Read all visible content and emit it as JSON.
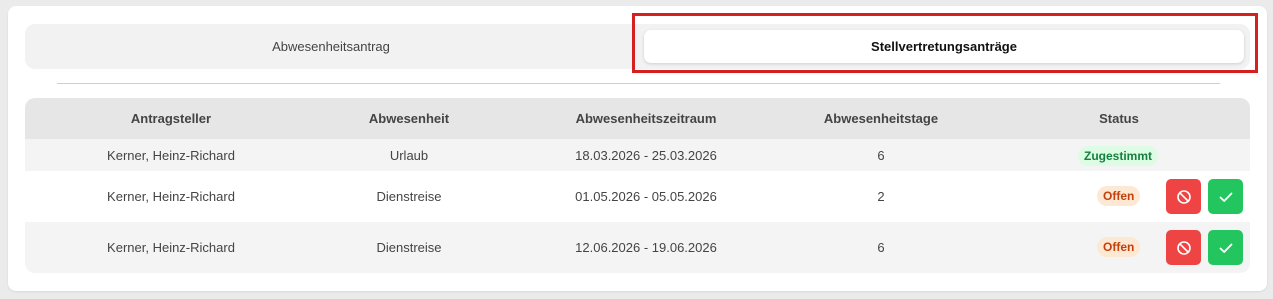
{
  "tabs": [
    {
      "label": "Abwesenheitsantrag",
      "active": false
    },
    {
      "label": "Stellvertretungsanträge",
      "active": true
    }
  ],
  "table": {
    "headers": [
      "Antragsteller",
      "Abwesenheit",
      "Abwesenheitszeitraum",
      "Abwesenheitstage",
      "Status"
    ],
    "rows": [
      {
        "applicant": "Kerner, Heinz-Richard",
        "absence": "Urlaub",
        "period": "18.03.2026 - 25.03.2026",
        "days": "6",
        "status": "Zugestimmt",
        "status_type": "approved"
      },
      {
        "applicant": "Kerner, Heinz-Richard",
        "absence": "Dienstreise",
        "period": "01.05.2026 - 05.05.2026",
        "days": "2",
        "status": "Offen",
        "status_type": "open"
      },
      {
        "applicant": "Kerner, Heinz-Richard",
        "absence": "Dienstreise",
        "period": "12.06.2026 - 19.06.2026",
        "days": "6",
        "status": "Offen",
        "status_type": "open"
      }
    ]
  },
  "actions": {
    "reject_icon": "ban-icon",
    "approve_icon": "check-icon"
  },
  "colors": {
    "highlight": "#d62020",
    "reject": "#ef4444",
    "approve": "#22c55e",
    "approved_badge": "#15803d",
    "open_badge": "#c2410c"
  }
}
